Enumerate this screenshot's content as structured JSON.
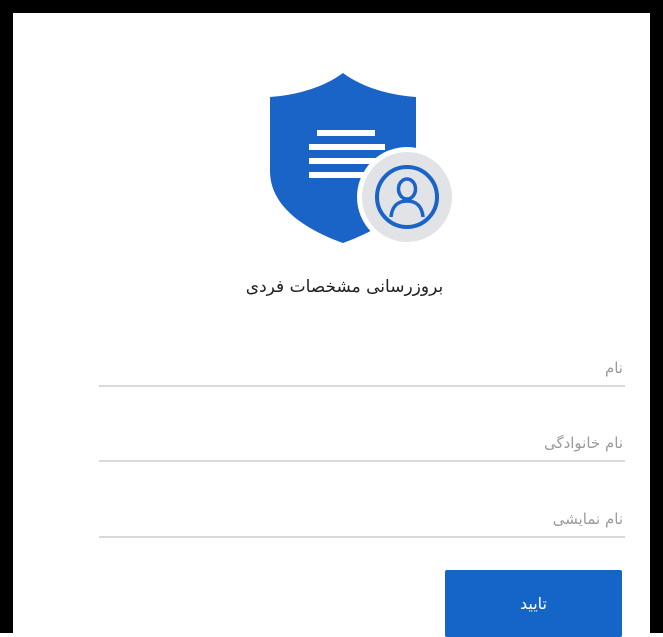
{
  "form": {
    "title": "بروزرسانی مشخصات فردی",
    "fields": [
      {
        "placeholder": "نام",
        "value": ""
      },
      {
        "placeholder": "نام خانوادگی",
        "value": ""
      },
      {
        "placeholder": "نام نمایشی",
        "value": ""
      }
    ],
    "submit_label": "تایید"
  },
  "icons": {
    "logo": "shield-document-user-icon"
  },
  "colors": {
    "accent": "#1565c9",
    "shield": "#1a64c8",
    "avatar_bg": "#e1e3e6",
    "frame": "#000000"
  }
}
